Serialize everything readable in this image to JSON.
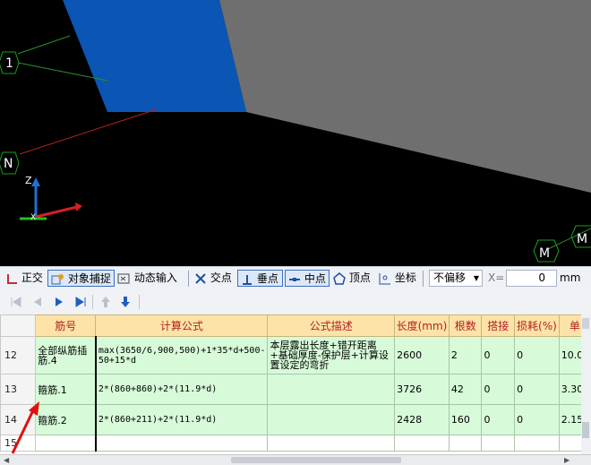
{
  "viewport": {
    "axis_markers": [
      "1",
      "N",
      "M",
      "M"
    ],
    "axis_labels": {
      "z": "Z",
      "x": "X"
    }
  },
  "toolbar": {
    "orthogonal": "正交",
    "object_snap": "对象捕捉",
    "dynamic_input": "动态输入",
    "intersection": "交点",
    "perpendicular": "垂点",
    "midpoint": "中点",
    "vertex": "顶点",
    "coordinate": "坐标",
    "offset_select": "不偏移",
    "x_label": "X=",
    "x_value": "0",
    "unit": "mm"
  },
  "table": {
    "headers": [
      "筋号",
      "计算公式",
      "公式描述",
      "长度(mm)",
      "根数",
      "搭接",
      "损耗(%)",
      "单"
    ],
    "rows": [
      {
        "num": "12",
        "name": "全部纵筋插筋.4",
        "formula": "max(3650/6,900,500)+1*35*d+500-50+15*d",
        "desc": "本层露出长度+错开距离+基础厚度-保护层+计算设置设定的弯折",
        "length": "2600",
        "count": "2",
        "lap": "0",
        "loss": "0",
        "unit": "10.0"
      },
      {
        "num": "13",
        "name": "箍筋.1",
        "formula": "2*(860+860)+2*(11.9*d)",
        "desc": "",
        "length": "3726",
        "count": "42",
        "lap": "0",
        "loss": "0",
        "unit": "3.30"
      },
      {
        "num": "14",
        "name": "箍筋.2",
        "formula": "2*(860+211)+2*(11.9*d)",
        "desc": "",
        "length": "2428",
        "count": "160",
        "lap": "0",
        "loss": "0",
        "unit": "2.15"
      },
      {
        "num": "15",
        "name": "",
        "formula": "",
        "desc": "",
        "length": "",
        "count": "",
        "lap": "",
        "loss": "",
        "unit": ""
      }
    ]
  },
  "colors": {
    "blue_panel": "#0b55b5",
    "gray_panel": "#6f6f6f",
    "axis_circle": "#19a119",
    "header_bg": "#fde3a7",
    "row_bg": "#d7fbd9"
  }
}
